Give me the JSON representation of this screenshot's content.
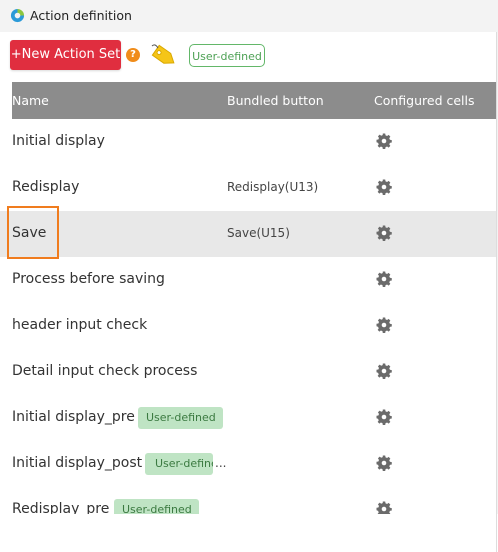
{
  "window": {
    "title": "Action definition"
  },
  "toolbar": {
    "new_action_set_label": "+New Action Set",
    "help_symbol": "?",
    "user_defined_label": "User-defined"
  },
  "table": {
    "columns": [
      "Name",
      "Bundled button",
      "Configured cells"
    ],
    "rows": [
      {
        "name": "Initial display",
        "bundled": "",
        "tag": ""
      },
      {
        "name": "Redisplay",
        "bundled": "Redisplay(U13)",
        "tag": ""
      },
      {
        "name": "Save",
        "bundled": "Save(U15)",
        "tag": ""
      },
      {
        "name": "Process before saving",
        "bundled": "",
        "tag": ""
      },
      {
        "name": "header input check",
        "bundled": "",
        "tag": ""
      },
      {
        "name": "Detail input check process",
        "bundled": "",
        "tag": ""
      },
      {
        "name": "Initial display_pre",
        "bundled": "",
        "tag": "User-defined"
      },
      {
        "name": "Initial display_post",
        "bundled": "...",
        "tag": "User-define"
      },
      {
        "name": "Redisplay_pre",
        "bundled": "",
        "tag": "User-defined"
      }
    ]
  },
  "colors": {
    "accent_red": "#e02e3f",
    "header_gray": "#8c8c8c",
    "tag_green": "#bfe4c4",
    "highlight_orange": "#f07c1e"
  },
  "icons": [
    "app-logo-icon",
    "help-icon",
    "tag-icon",
    "gear-icon"
  ]
}
